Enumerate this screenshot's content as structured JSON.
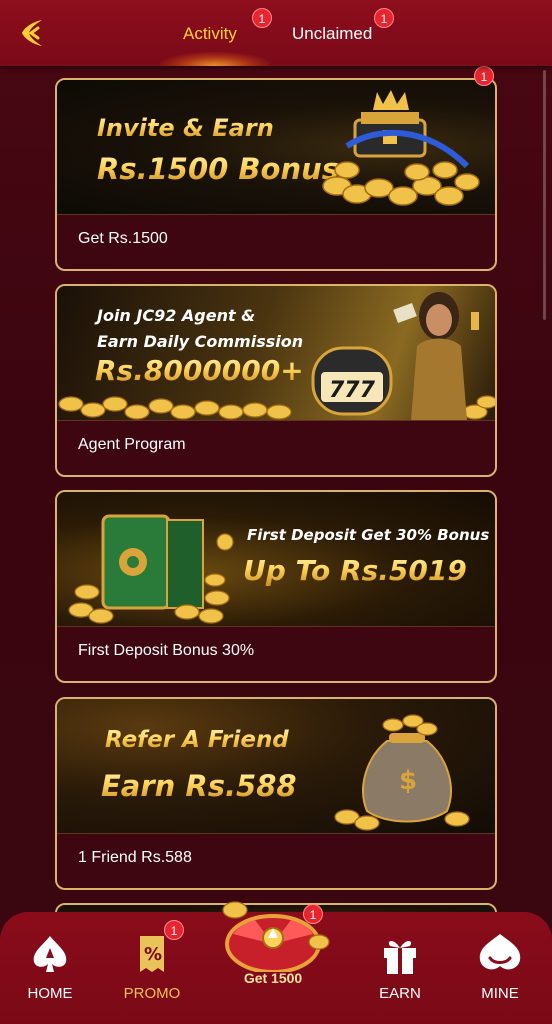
{
  "header": {
    "tabs": [
      {
        "label": "Activity",
        "badge": "1",
        "active": true
      },
      {
        "label": "Unclaimed",
        "badge": "1",
        "active": false
      }
    ]
  },
  "cards": [
    {
      "badge": "1",
      "banner_lines": [
        "Invite & Earn",
        "Rs.1500 Bonus"
      ],
      "caption": "Get Rs.1500"
    },
    {
      "banner_lines": [
        "Join JC92 Agent &",
        "Earn Daily Commission",
        "Rs.8000000+",
        "777"
      ],
      "caption": "Agent Program"
    },
    {
      "banner_lines": [
        "First Deposit Get 30% Bonus",
        "Up To Rs.5019"
      ],
      "caption": "First Deposit Bonus 30%"
    },
    {
      "banner_lines": [
        "Refer A Friend",
        "Earn Rs.588"
      ],
      "caption": "1 Friend Rs.588"
    }
  ],
  "bottom_nav": {
    "items": [
      {
        "label": "HOME"
      },
      {
        "label": "PROMO",
        "badge": "1",
        "active": true
      },
      {
        "label": "Get 1500",
        "badge": "1"
      },
      {
        "label": "EARN"
      },
      {
        "label": "MINE"
      }
    ]
  },
  "colors": {
    "accent": "#ffcf3a",
    "header_bg": "#8e0e1d",
    "page_bg": "#3a0610",
    "card_border": "#d9b46a",
    "badge": "#e8252e"
  }
}
